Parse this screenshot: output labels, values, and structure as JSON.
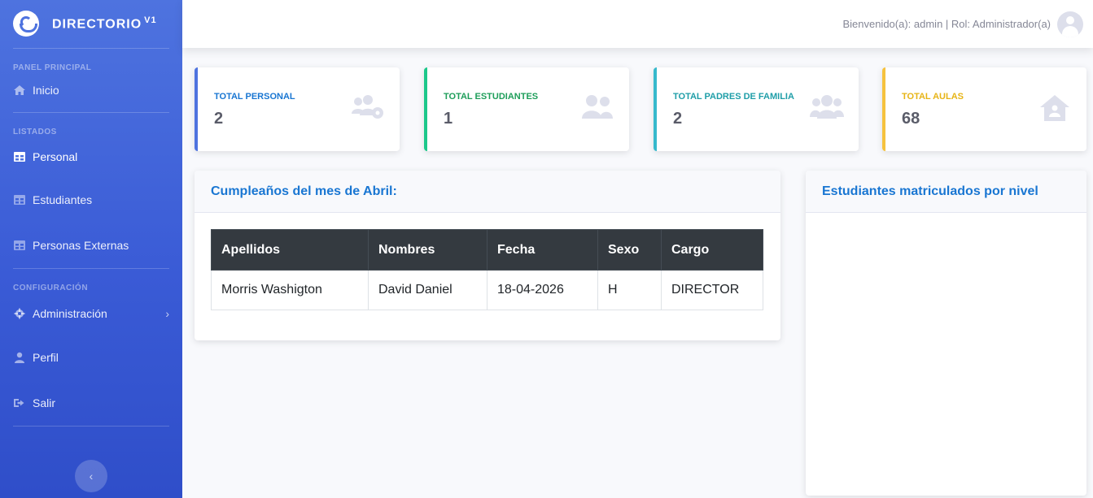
{
  "brand": {
    "name": "DIRECTORIO",
    "version": "V1"
  },
  "sidebar": {
    "sections": {
      "panel": "PANEL PRINCIPAL",
      "listados": "LISTADOS",
      "configuracion": "CONFIGURACIÓN"
    },
    "items": [
      {
        "label": "Inicio",
        "icon": "home-icon"
      },
      {
        "label": "Personal",
        "icon": "table-icon"
      },
      {
        "label": "Estudiantes",
        "icon": "table-icon"
      },
      {
        "label": "Personas Externas",
        "icon": "table-icon"
      },
      {
        "label": "Administración",
        "icon": "gear-icon"
      },
      {
        "label": "Perfil",
        "icon": "user-icon"
      },
      {
        "label": "Salir",
        "icon": "sign-out-icon"
      }
    ],
    "toggle_icon": "chevron-left-icon"
  },
  "topbar": {
    "welcome": "Bienvenido(a): admin | Rol: Administrador(a)"
  },
  "stats": [
    {
      "label": "TOTAL PERSONAL",
      "value": "2",
      "color": "#4e73df",
      "label_color": "#1976d2",
      "icon": "users-cog-icon"
    },
    {
      "label": "TOTAL ESTUDIANTES",
      "value": "1",
      "color": "#1cc88a",
      "label_color": "#1e9e5a",
      "icon": "user-friends-icon"
    },
    {
      "label": "TOTAL PADRES DE FAMILIA",
      "value": "2",
      "color": "#36b9cc",
      "label_color": "#1f9ea8",
      "icon": "users-icon"
    },
    {
      "label": "TOTAL AULAS",
      "value": "68",
      "color": "#f6c23e",
      "label_color": "#e7b416",
      "icon": "house-user-icon"
    }
  ],
  "birthdays": {
    "title": "Cumpleaños del mes de Abril:",
    "columns": [
      "Apellidos",
      "Nombres",
      "Fecha",
      "Sexo",
      "Cargo"
    ],
    "rows": [
      [
        "Morris Washigton",
        "David Daniel",
        "18-04-2026",
        "H",
        "DIRECTOR"
      ]
    ]
  },
  "enrolled": {
    "title": "Estudiantes matriculados por nivel"
  },
  "colors": {
    "primary": "#4e73df",
    "title_blue": "#1976d2",
    "table_header": "#343a40"
  }
}
